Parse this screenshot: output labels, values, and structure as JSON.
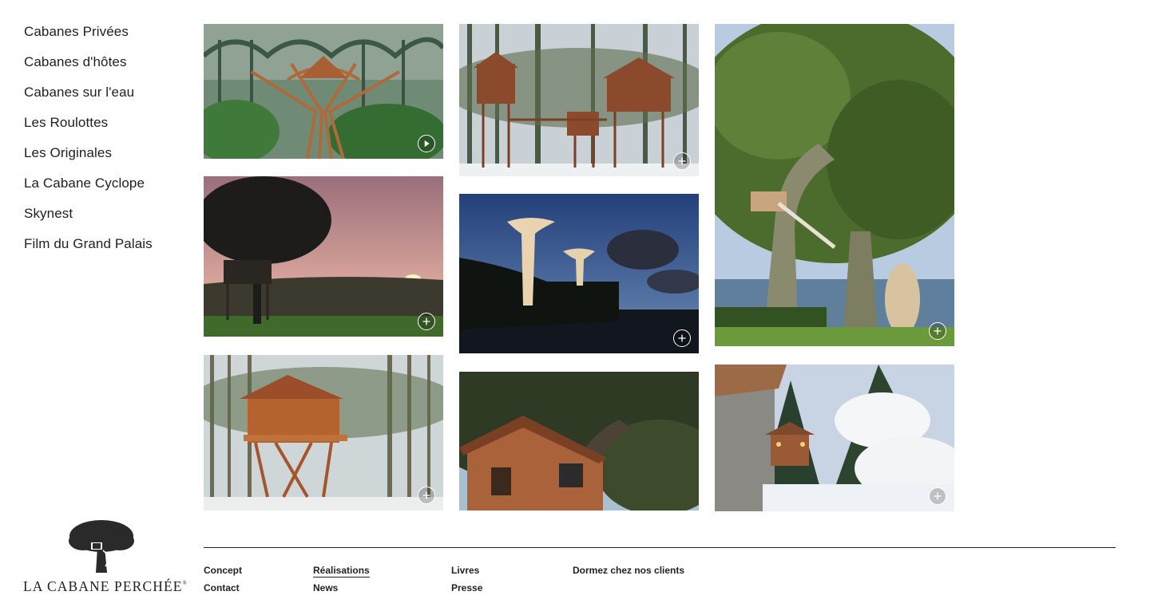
{
  "sidebar": {
    "items": [
      {
        "label": "Cabanes Privées"
      },
      {
        "label": "Cabanes d'hôtes"
      },
      {
        "label": "Cabanes sur l'eau"
      },
      {
        "label": "Les Roulottes"
      },
      {
        "label": "Les Originales"
      },
      {
        "label": "La Cabane Cyclope"
      },
      {
        "label": "Skynest"
      },
      {
        "label": "Film du Grand Palais"
      }
    ]
  },
  "gallery": {
    "tiles": [
      {
        "subject": "treehouse-sculpture-grand-palais",
        "icon": "play-icon"
      },
      {
        "subject": "forest-treehouses-complex",
        "icon": "plus-icon"
      },
      {
        "subject": "oak-treehouse-lakeside",
        "icon": "plus-icon"
      },
      {
        "subject": "treehouse-sunset",
        "icon": "plus-icon"
      },
      {
        "subject": "skynest-palms-dusk",
        "icon": "plus-icon"
      },
      {
        "subject": "pine-forest-treehouse",
        "icon": "plus-icon"
      },
      {
        "subject": "cabin-in-oak-canopy",
        "icon": "plus-icon"
      },
      {
        "subject": "snowy-mountain-chalet",
        "icon": "plus-icon"
      }
    ]
  },
  "brand": {
    "name": "LA CABANE PERCHÉE",
    "mark": "®"
  },
  "footer": {
    "links": [
      {
        "label": "Concept",
        "active": false
      },
      {
        "label": "Contact",
        "active": false
      },
      {
        "label": "Réalisations",
        "active": true
      },
      {
        "label": "News",
        "active": false
      },
      {
        "label": "Livres",
        "active": false
      },
      {
        "label": "Presse",
        "active": false
      },
      {
        "label": "Dormez chez nos clients",
        "active": false
      }
    ]
  },
  "colors": {
    "text": "#1f1f1f",
    "divider": "#222222",
    "background": "#ffffff"
  }
}
